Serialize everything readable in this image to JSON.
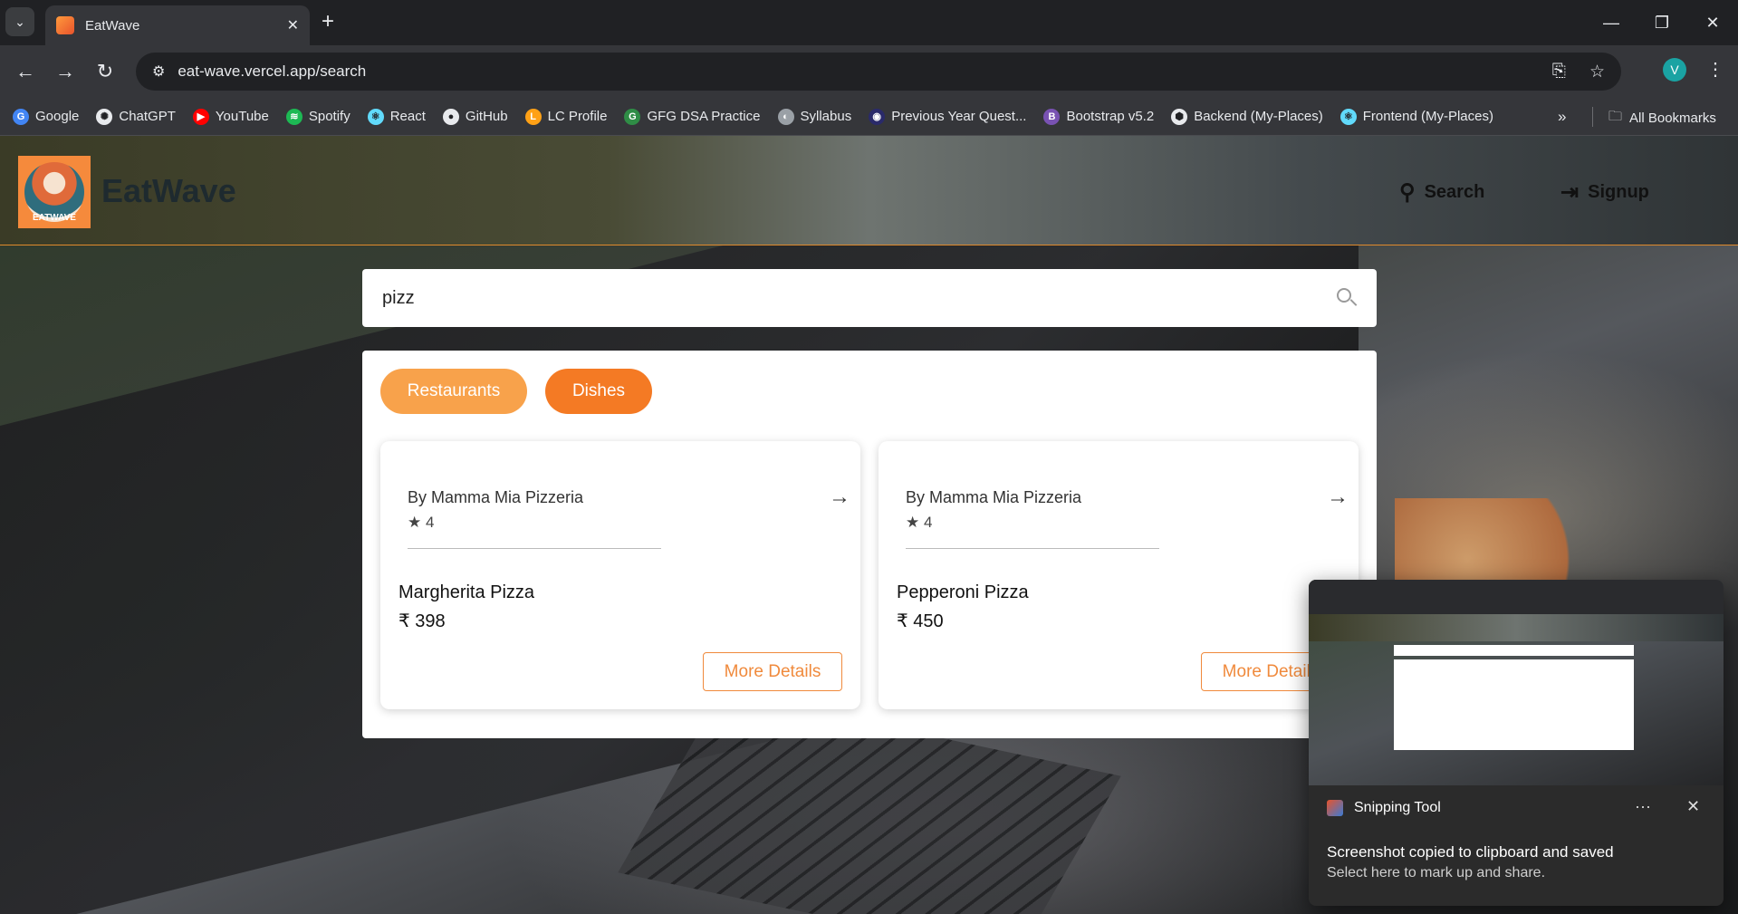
{
  "browser": {
    "tab_title": "EatWave",
    "url": "eat-wave.vercel.app/search",
    "profile_initial": "V",
    "bookmarks": [
      {
        "label": "Google",
        "color": "#4285f4",
        "glyph": "G"
      },
      {
        "label": "ChatGPT",
        "color": "#e8eaed",
        "glyph": "✺"
      },
      {
        "label": "YouTube",
        "color": "#ff0000",
        "glyph": "▶"
      },
      {
        "label": "Spotify",
        "color": "#1db954",
        "glyph": "≋"
      },
      {
        "label": "React",
        "color": "#61dafb",
        "glyph": "⚛"
      },
      {
        "label": "GitHub",
        "color": "#e8eaed",
        "glyph": "●"
      },
      {
        "label": "LC Profile",
        "color": "#ffa116",
        "glyph": "L"
      },
      {
        "label": "GFG DSA Practice",
        "color": "#2f8d46",
        "glyph": "G"
      },
      {
        "label": "Syllabus",
        "color": "#9aa0a6",
        "glyph": "◐"
      },
      {
        "label": "Previous Year Quest...",
        "color": "#2a2a6a",
        "glyph": "◉"
      },
      {
        "label": "Bootstrap v5.2",
        "color": "#7952b3",
        "glyph": "B"
      },
      {
        "label": "Backend (My-Places)",
        "color": "#e8eaed",
        "glyph": "⬢"
      },
      {
        "label": "Frontend (My-Places)",
        "color": "#61dafb",
        "glyph": "⚛"
      }
    ],
    "all_bookmarks_label": "All Bookmarks"
  },
  "header": {
    "brand": "EatWave",
    "logo_text": "EATWAVE",
    "nav": {
      "search": "Search",
      "signup": "Signup"
    }
  },
  "search": {
    "value": "pizz"
  },
  "filters": {
    "restaurants": "Restaurants",
    "dishes": "Dishes"
  },
  "results": [
    {
      "restaurant": "By Mamma Mia Pizzeria",
      "rating": "4",
      "dish": "Margherita Pizza",
      "price": "₹ 398",
      "button": "More Details"
    },
    {
      "restaurant": "By Mamma Mia Pizzeria",
      "rating": "4",
      "dish": "Pepperoni Pizza",
      "price": "₹ 450",
      "button": "More Details"
    }
  ],
  "toast": {
    "app": "Snipping Tool",
    "title": "Screenshot copied to clipboard and saved",
    "subtitle": "Select here to mark up and share."
  },
  "colors": {
    "accent_orange": "#f47a24",
    "accent_orange_light": "#f8a24b"
  }
}
